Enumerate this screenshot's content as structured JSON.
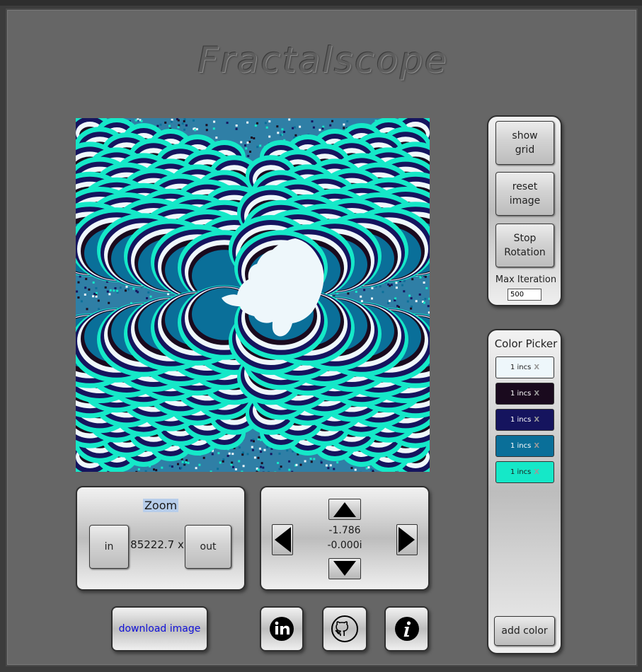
{
  "app": {
    "title": "Fractalscope"
  },
  "controls": {
    "show_grid": "show\ngrid",
    "reset_image": "reset\nimage",
    "stop_rotation": "Stop\nRotation",
    "max_iteration_label": "Max Iteration",
    "max_iteration_value": "500"
  },
  "color_picker": {
    "title": "Color Picker",
    "swatches": [
      {
        "label": "1 incs",
        "remove": "X",
        "color": "#eef7fb",
        "text_color": "#1a1a1a"
      },
      {
        "label": "1 incs",
        "remove": "X",
        "color": "#1a0a1e",
        "text_color": "#ffffff"
      },
      {
        "label": "1 incs",
        "remove": "X",
        "color": "#15145e",
        "text_color": "#ffffff"
      },
      {
        "label": "1 incs",
        "remove": "X",
        "color": "#0a6f99",
        "text_color": "#ffffff"
      },
      {
        "label": "1 incs",
        "remove": "X",
        "color": "#15e8c8",
        "text_color": "#1a1a1a"
      }
    ],
    "add_color": "add color"
  },
  "zoom": {
    "title": "Zoom",
    "in_label": "in",
    "out_label": "out",
    "value": "85222.7 x"
  },
  "navigation": {
    "real": "-1.786",
    "imaginary": "-0.000i"
  },
  "footer": {
    "download_label": "download image",
    "linkedin_icon": "linkedin-icon",
    "github_icon": "github-icon",
    "info_icon": "info-icon"
  },
  "colors": {
    "background": "#666666",
    "link_blue": "#1010d8",
    "fractal_palette": [
      "#eef7fb",
      "#1a0a1e",
      "#15145e",
      "#0a6f99",
      "#15e8c8"
    ]
  }
}
